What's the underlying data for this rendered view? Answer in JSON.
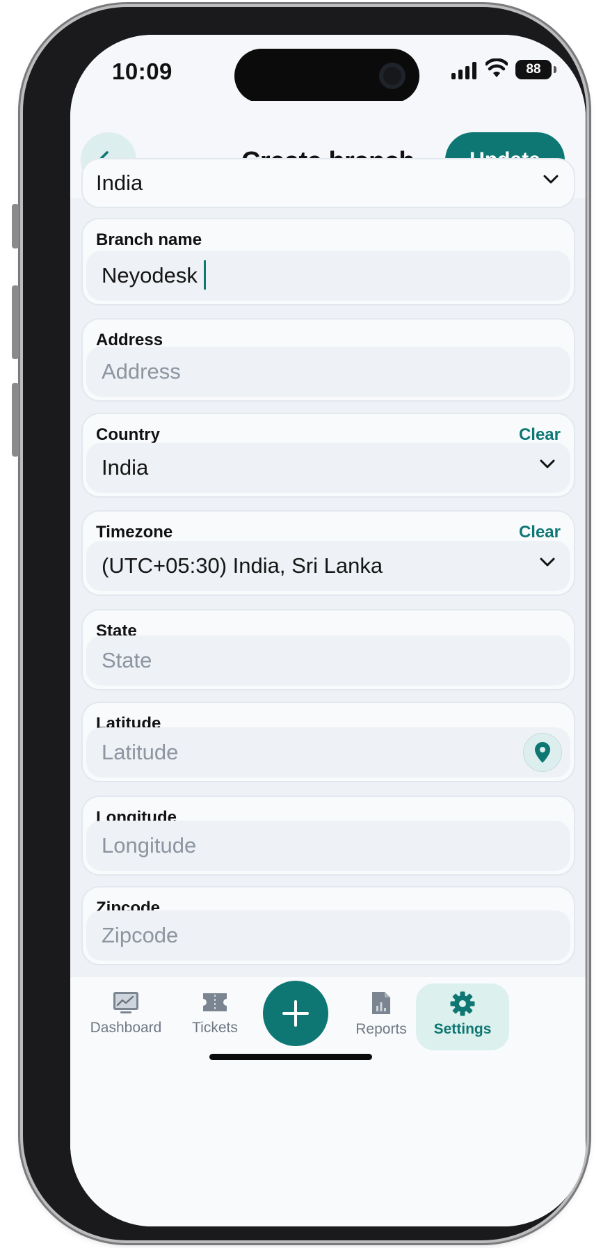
{
  "status_bar": {
    "time": "10:09",
    "battery": "88"
  },
  "header": {
    "title": "Create branch",
    "update_label": "Update"
  },
  "top_select": {
    "value": "India"
  },
  "fields": {
    "branch_name": {
      "label": "Branch name",
      "value": "Neyodesk"
    },
    "address": {
      "label": "Address",
      "placeholder": "Address"
    },
    "country": {
      "label": "Country",
      "clear_label": "Clear",
      "value": "India"
    },
    "timezone": {
      "label": "Timezone",
      "clear_label": "Clear",
      "value": "(UTC+05:30) India, Sri Lanka"
    },
    "state": {
      "label": "State",
      "placeholder": "State"
    },
    "latitude": {
      "label": "Latitude",
      "placeholder": "Latitude"
    },
    "longitude": {
      "label": "Longitude",
      "placeholder": "Longitude"
    },
    "zipcode": {
      "label": "Zipcode",
      "placeholder": "Zipcode"
    }
  },
  "tabbar": {
    "tabs": [
      {
        "label": "Dashboard",
        "icon": "dashboard-icon"
      },
      {
        "label": "Tickets",
        "icon": "ticket-icon"
      },
      {
        "label": "Reports",
        "icon": "report-icon"
      },
      {
        "label": "Settings",
        "icon": "gear-icon",
        "active": true
      }
    ],
    "fab_icon": "plus-icon"
  },
  "colors": {
    "accent": "#0e7773",
    "accent_light": "#dceeed",
    "background": "#eef1f6"
  }
}
